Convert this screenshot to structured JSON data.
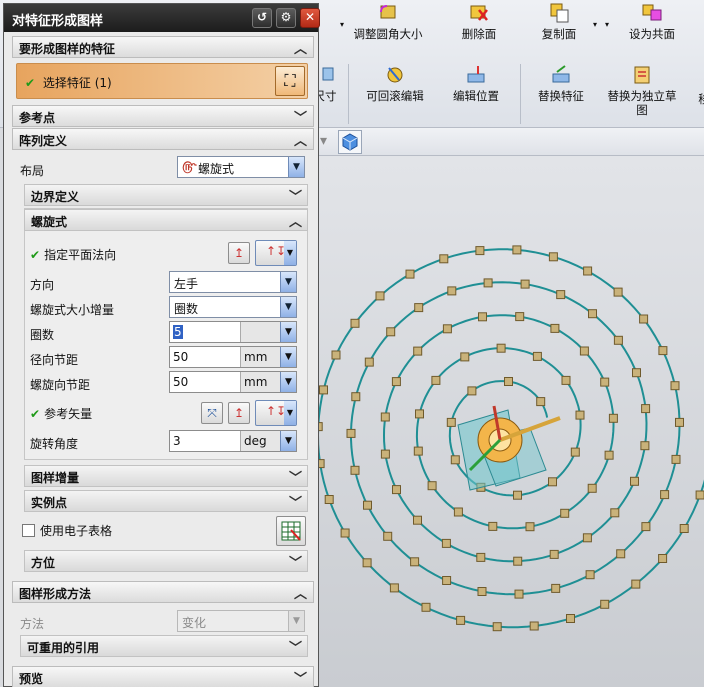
{
  "ribbon": {
    "row1": [
      {
        "label": "调整圆角大小",
        "icon": "round-corner-icon"
      },
      {
        "label": "删除面",
        "icon": "delete-face-icon"
      },
      {
        "label": "复制面",
        "icon": "copy-face-icon"
      },
      {
        "label": "设为共面",
        "icon": "coplanar-icon"
      }
    ],
    "row2": [
      {
        "label": "尺寸",
        "icon": "dimension-icon"
      },
      {
        "label": "可回滚编辑",
        "icon": "rollback-edit-icon"
      },
      {
        "label": "编辑位置",
        "icon": "edit-position-icon"
      },
      {
        "label": "替换特征",
        "icon": "replace-feature-icon"
      },
      {
        "label": "替换为独立草图",
        "icon": "independent-sketch-icon"
      },
      {
        "label": "移",
        "icon": ""
      }
    ]
  },
  "dialog": {
    "title": "对特征形成图样",
    "sections": {
      "features": {
        "header": "要形成图样的特征",
        "select_label": "选择特征 (1)"
      },
      "reference_point": {
        "header": "参考点"
      },
      "array_def": {
        "header": "阵列定义",
        "layout_label": "布局",
        "layout_value": "螺旋式",
        "boundary": {
          "header": "边界定义"
        },
        "spiral": {
          "header": "螺旋式",
          "plane_normal_label": "指定平面法向",
          "direction_label": "方向",
          "direction_value": "左手",
          "size_increment_label": "螺旋式大小增量",
          "size_increment_value": "圈数",
          "turns_label": "圈数",
          "turns_value": "5",
          "radial_pitch_label": "径向节距",
          "radial_pitch_value": "50",
          "radial_pitch_unit": "mm",
          "spiral_pitch_label": "螺旋向节距",
          "spiral_pitch_value": "50",
          "spiral_pitch_unit": "mm",
          "ref_vector_label": "参考矢量",
          "rotation_label": "旋转角度",
          "rotation_value": "3",
          "rotation_unit": "deg"
        },
        "pattern_increment": {
          "header": "图样增量"
        },
        "instance_point": {
          "header": "实例点"
        },
        "use_spreadsheet_label": "使用电子表格",
        "use_spreadsheet_checked": false,
        "orientation": {
          "header": "方位"
        }
      },
      "method": {
        "header": "图样形成方法",
        "method_label": "方法",
        "method_value": "变化",
        "reusable_ref": {
          "header": "可重用的引用"
        }
      },
      "preview": {
        "header": "预览"
      }
    }
  },
  "colors": {
    "spiral": "#1f8f94",
    "instance": "#c9b27a",
    "accent": "#e7a45e"
  }
}
